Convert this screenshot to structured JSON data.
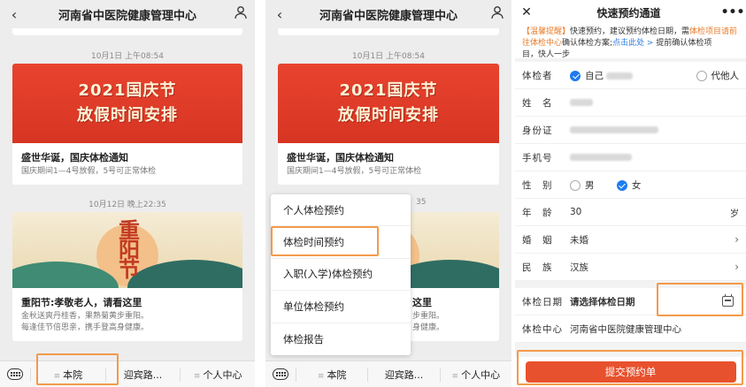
{
  "app": {
    "header_title": "河南省中医院健康管理中心",
    "back_icon": "chevron-left-icon",
    "user_icon": "user-icon"
  },
  "feed": {
    "posts": [
      {
        "date": "10月1日 上午08:54",
        "banner_lines": [
          "2021国庆节",
          "放假时间安排"
        ],
        "title": "盛世华诞，国庆体检通知",
        "desc": "国庆期间1—4号放假，5号可正常体检"
      },
      {
        "date": "10月12日 晚上22:35",
        "banner_text": "重阳节",
        "title": "重阳节:孝敬老人，请看这里",
        "desc_lines": [
          "金秋送爽丹桂香，果熟菊黄步重阳。",
          "每逢佳节倍思亲，携手登高身健康。"
        ]
      }
    ]
  },
  "menu_panel2": {
    "date2_partial": "35",
    "title2_partial": "这里",
    "desc2_partial": [
      "步重阳。",
      "身健康。"
    ],
    "items": [
      "个人体检预约",
      "体检时间预约",
      "入职(入学)体检预约",
      "单位体检预约",
      "体检报告"
    ]
  },
  "bottom_bar": {
    "keyboard_icon": "keyboard-icon",
    "tabs": [
      "本院",
      "迎宾路...",
      "个人中心"
    ]
  },
  "form": {
    "top_title": "快速预约通道",
    "close_icon": "close-icon",
    "more_icon": "more-icon",
    "notice": {
      "line1_o": "【温馨提醒】",
      "line1": "快速预约，建议预约体检日期，需",
      "line1_o2": "体检项目请前",
      "line2_o": "往体检中心",
      "line2": "确认体检方案;",
      "line2_b": "点击此处 >",
      "line2_end": " 提前确认体检项",
      "line3": "目，快人一步"
    },
    "examinee_label": "体检者",
    "self_label": "自己",
    "other_label": "代他人",
    "name_label": "姓　名",
    "id_label": "身份证",
    "phone_label": "手机号",
    "gender_label": "性　别",
    "male": "男",
    "female": "女",
    "age_label": "年　龄",
    "age_value": "30",
    "age_unit": "岁",
    "marriage_label": "婚　姻",
    "marriage_value": "未婚",
    "ethnic_label": "民　族",
    "ethnic_value": "汉族",
    "date_label": "体检日期",
    "date_placeholder": "请选择体检日期",
    "center_label": "体检中心",
    "center_value": "河南省中医院健康管理中心",
    "submit": "提交预约单",
    "chevron": "›"
  },
  "colors": {
    "highlight": "#f39a4a",
    "submit": "#e8512d",
    "banner_red": "#e8432f",
    "radio_on": "#1e7bf0"
  }
}
